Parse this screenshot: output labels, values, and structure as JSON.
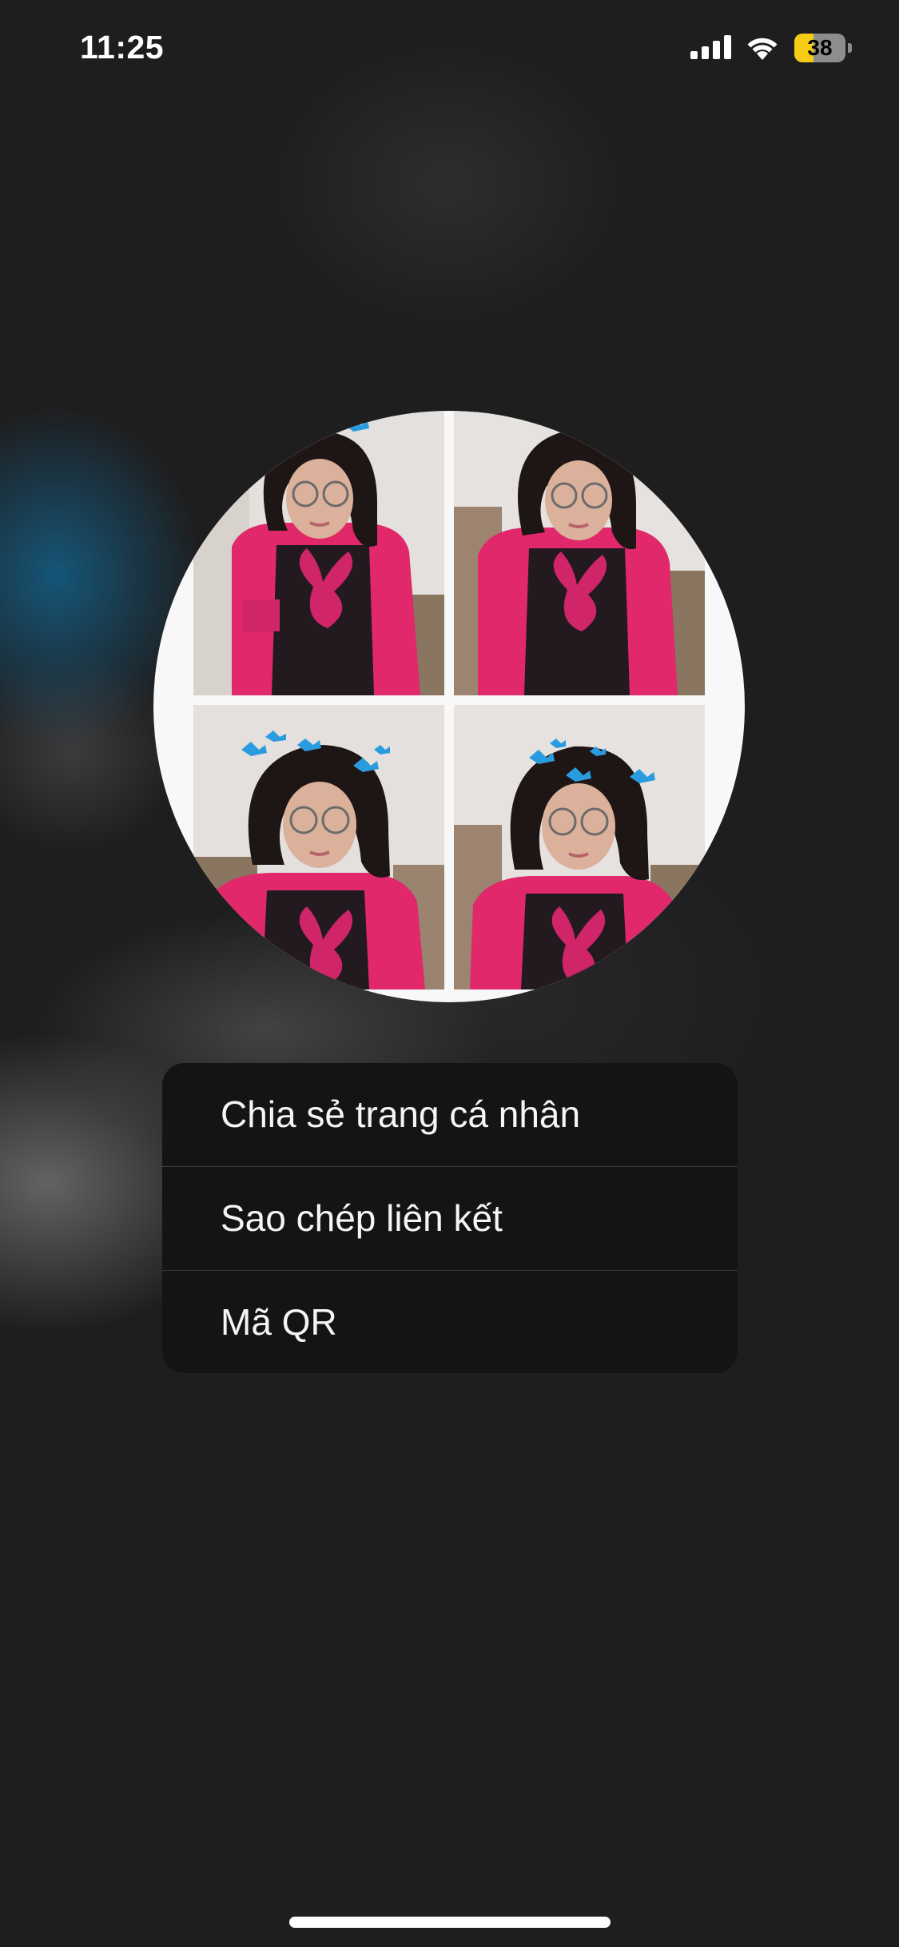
{
  "status_bar": {
    "time": "11:25",
    "battery_level": "38",
    "battery_fraction": 0.38,
    "signal_icon": "cellular-signal-icon",
    "wifi_icon": "wifi-icon"
  },
  "profile": {
    "photo": "profile-photo-collage"
  },
  "menu": {
    "items": [
      {
        "label": "Chia sẻ trang cá nhân"
      },
      {
        "label": "Sao chép liên kết"
      },
      {
        "label": "Mã QR"
      }
    ]
  },
  "colors": {
    "background": "#1e1e1f",
    "menu_background": "#141415",
    "menu_text": "#f5f5f7",
    "battery_accent": "#f4cc15",
    "shirt_pink": "#e0286a"
  }
}
